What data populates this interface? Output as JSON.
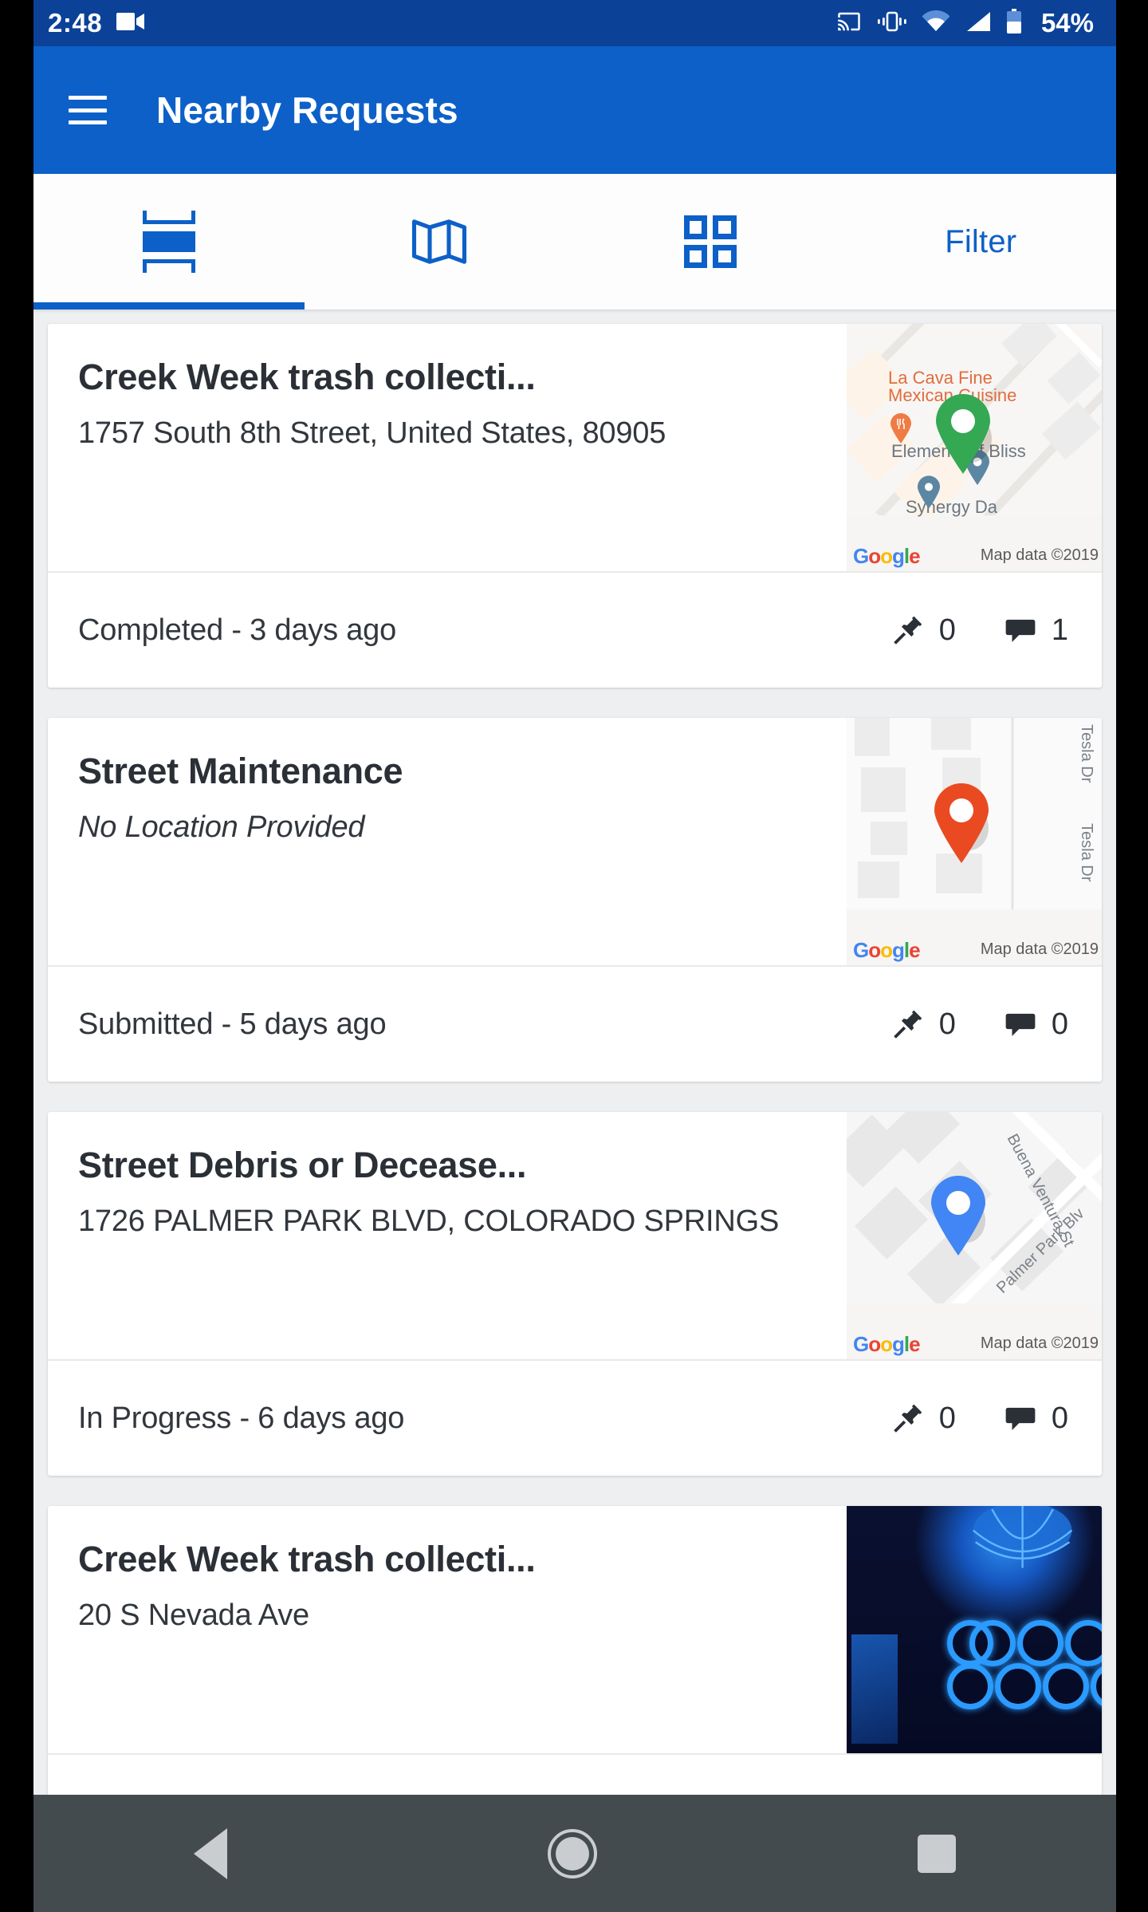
{
  "status_bar": {
    "time": "2:48",
    "battery_percent": "54%",
    "icons": [
      "video-camera-icon",
      "cast-icon",
      "vibrate-icon",
      "wifi-icon",
      "cell-signal-icon",
      "battery-icon"
    ]
  },
  "app_bar": {
    "menu_icon": "hamburger-menu-icon",
    "title": "Nearby Requests"
  },
  "tabs": {
    "items": [
      {
        "name": "list-view",
        "icon": "list-view-icon",
        "label": "",
        "active": true
      },
      {
        "name": "map-view",
        "icon": "map-icon",
        "label": "",
        "active": false
      },
      {
        "name": "grid-view",
        "icon": "grid-icon",
        "label": "",
        "active": false
      },
      {
        "name": "filter",
        "icon": "",
        "label": "Filter",
        "active": false
      }
    ]
  },
  "colors": {
    "status_bar": "#0b4298",
    "app_bar": "#0d60c8",
    "accent": "#0d60c8",
    "page_bg": "#eeeff1",
    "card_bg": "#ffffff",
    "nav_bar": "#434b4f",
    "marker_green": "#34a853",
    "marker_red": "#ea4335",
    "marker_blue": "#4285f4"
  },
  "requests": [
    {
      "title": "Creek Week trash collecti...",
      "address": "1757   South 8th Street, United States, 80905",
      "address_italic": false,
      "status": "Completed - 3 days ago",
      "pin_icon": "pushpin-icon",
      "pin_count": "0",
      "comment_icon": "comment-bubble-icon",
      "comment_count": "1",
      "thumb_type": "map",
      "map": {
        "marker_color": "#34a853",
        "pois": [
          {
            "text": "La Cava Fine",
            "color": "orange"
          },
          {
            "text": "Mexican Cuisine",
            "color": "orange"
          },
          {
            "text": "Elements of Bliss",
            "color": "gray"
          },
          {
            "text": "Synergy Da",
            "color": "gray"
          }
        ],
        "streets": [],
        "google_logo": "Google",
        "attribution": "Map data ©2019"
      }
    },
    {
      "title": "Street Maintenance",
      "address": "No Location Provided",
      "address_italic": true,
      "status": "Submitted - 5 days ago",
      "pin_icon": "pushpin-icon",
      "pin_count": "0",
      "comment_icon": "comment-bubble-icon",
      "comment_count": "0",
      "thumb_type": "map",
      "map": {
        "marker_color": "#ea4335",
        "pois": [],
        "streets": [
          "Tesla Dr",
          "Tesla Dr"
        ],
        "google_logo": "Google",
        "attribution": "Map data ©2019"
      }
    },
    {
      "title": "Street Debris or Decease...",
      "address": "1726   PALMER PARK BLVD, COLORADO SPRINGS",
      "address_italic": false,
      "status": "In Progress - 6 days ago",
      "pin_icon": "pushpin-icon",
      "pin_count": "0",
      "comment_icon": "comment-bubble-icon",
      "comment_count": "0",
      "thumb_type": "map",
      "map": {
        "marker_color": "#4285f4",
        "pois": [],
        "streets": [
          "Buena Ventura St",
          "Palmer Park Blv"
        ],
        "google_logo": "Google",
        "attribution": "Map data ©2019"
      }
    },
    {
      "title": "Creek Week trash collecti...",
      "address": "20   S Nevada Ave",
      "address_italic": false,
      "status": "",
      "pin_icon": "",
      "pin_count": "",
      "comment_icon": "",
      "comment_count": "",
      "thumb_type": "photo",
      "map": null
    }
  ],
  "nav_bar": {
    "back": "back-triangle-icon",
    "home": "home-circle-icon",
    "recents": "recents-square-icon"
  }
}
